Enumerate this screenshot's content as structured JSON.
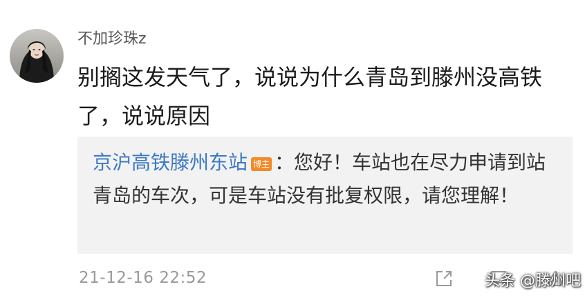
{
  "comment": {
    "username": "不加珍珠z",
    "text": "别搁这发天气了，说说为什么青岛到滕州没高铁了，说说原因",
    "avatar_icon": "avatar-portrait"
  },
  "reply": {
    "author": "京沪高铁滕州东站",
    "badge": "博主",
    "text": "：您好！车站也在尽力申请到站青岛的车次，可是车站没有批复权限，请您理解！"
  },
  "footer": {
    "timestamp": "21-12-16 22:52",
    "icons": [
      "share-icon",
      "comment-icon",
      "like-icon"
    ]
  },
  "watermark": {
    "text": "头条 @滕州吧"
  },
  "colors": {
    "author_link": "#3c79c4",
    "badge_bg": "#f38a2a",
    "reply_bg": "#f2f2f2",
    "muted": "#999999"
  }
}
